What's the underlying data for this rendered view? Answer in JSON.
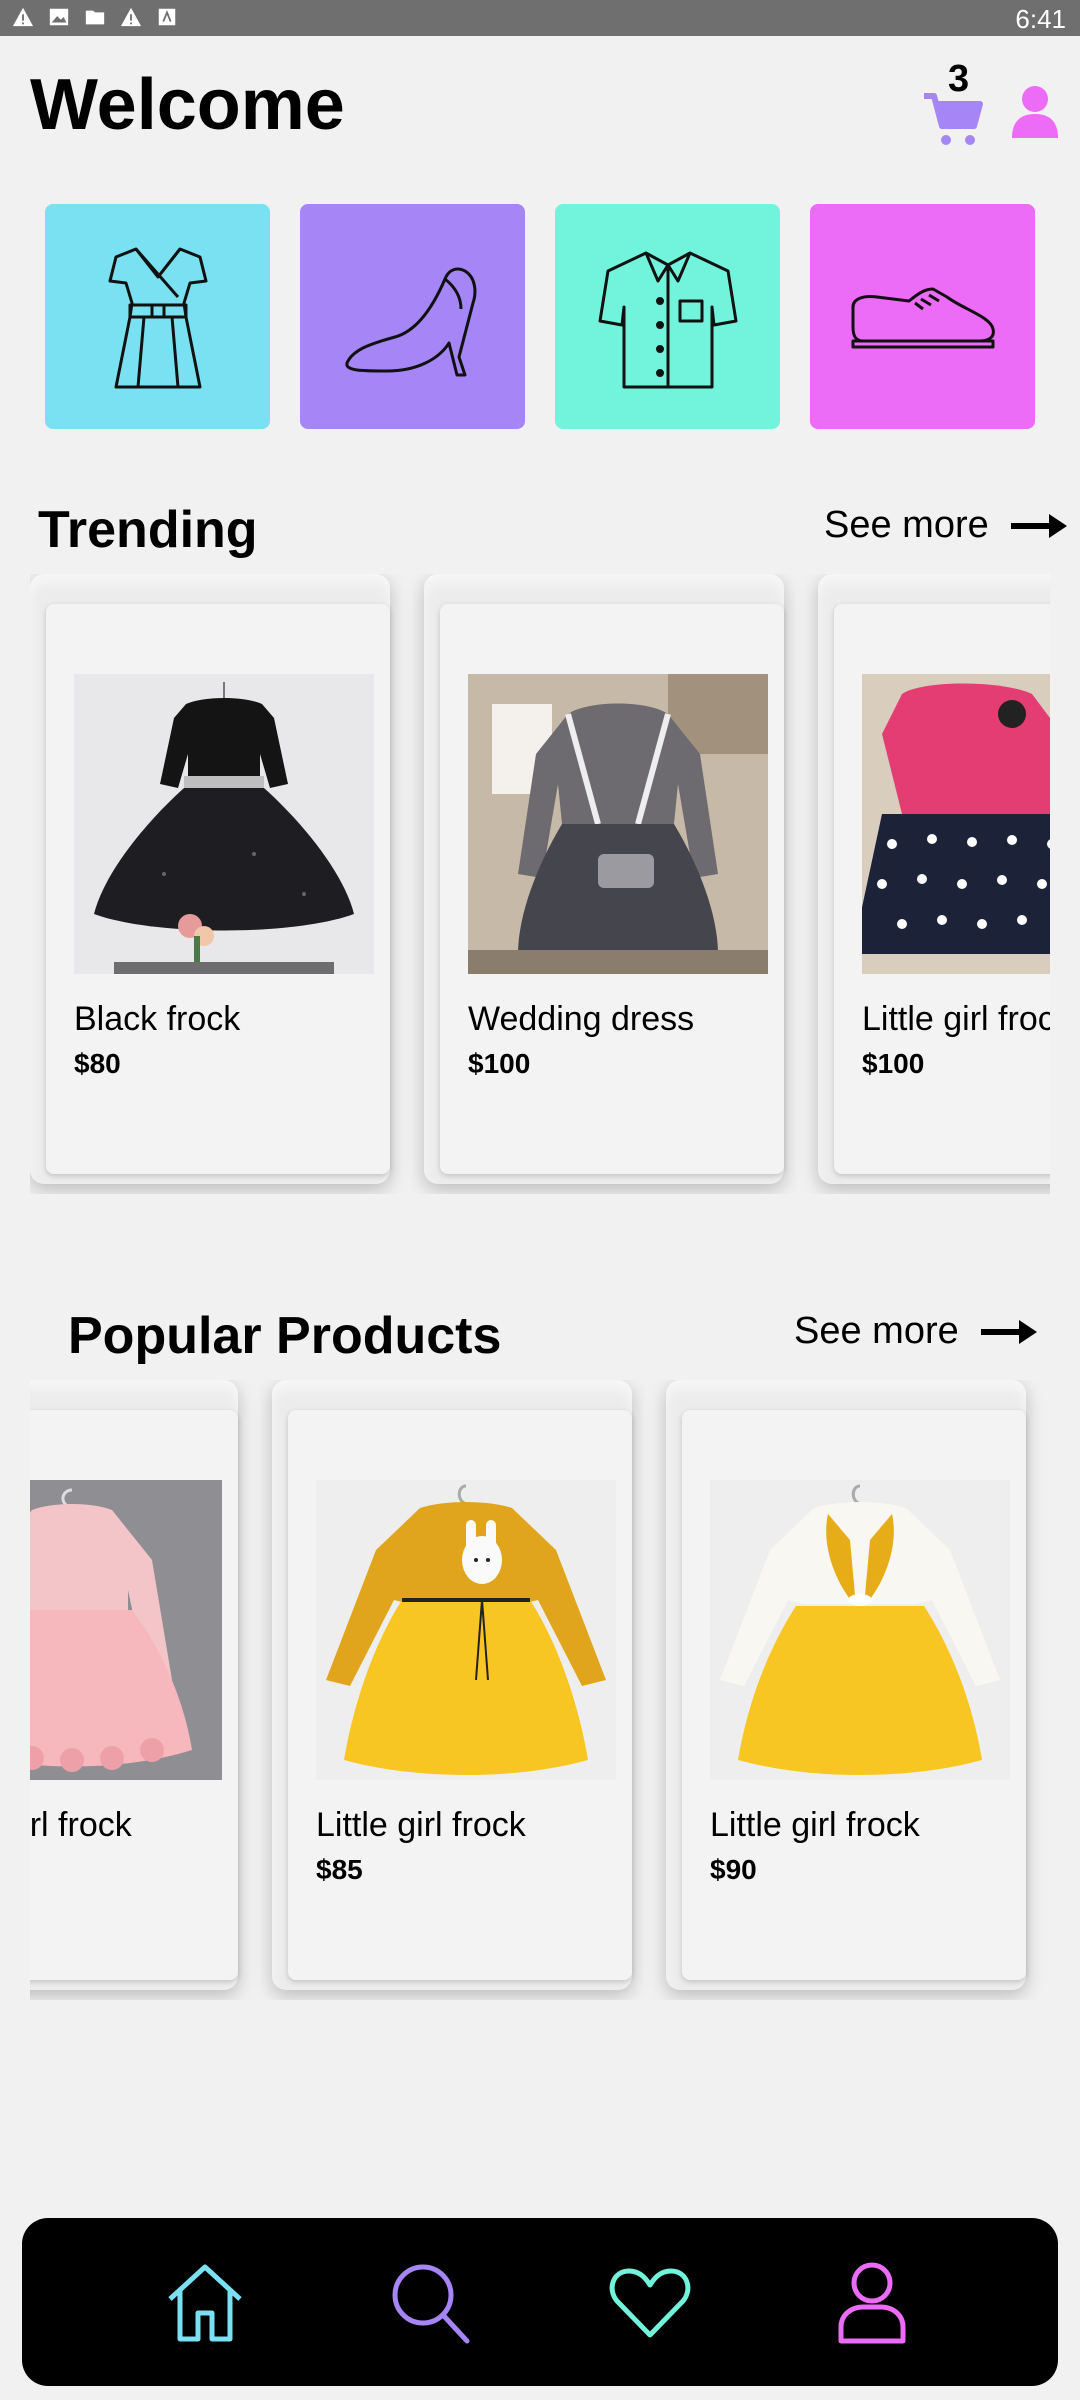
{
  "status_bar": {
    "time": "6:41"
  },
  "header": {
    "title": "Welcome",
    "cart_count": "3"
  },
  "categories": [
    {
      "icon": "dress-icon",
      "color": "#79e1f1"
    },
    {
      "icon": "high-heel-icon",
      "color": "#a685f6"
    },
    {
      "icon": "shirt-icon",
      "color": "#72f4dc"
    },
    {
      "icon": "shoe-icon",
      "color": "#ec6bf7"
    }
  ],
  "trending": {
    "title": "Trending",
    "see_more": "See more",
    "products": [
      {
        "name": "Black frock",
        "price": "$80"
      },
      {
        "name": "Wedding dress",
        "price": "$100"
      },
      {
        "name": "Little girl frock",
        "price": "$100"
      }
    ]
  },
  "popular": {
    "title": "Popular Products",
    "see_more": "See more",
    "products": [
      {
        "name": "Little girl frock",
        "price": ""
      },
      {
        "name": "Little girl frock",
        "price": "$85"
      },
      {
        "name": "Little girl frock",
        "price": "$90"
      }
    ]
  },
  "bottom_nav": {
    "items": [
      {
        "icon": "home-icon",
        "color": "#79e1f1"
      },
      {
        "icon": "search-icon",
        "color": "#a685f6"
      },
      {
        "icon": "heart-icon",
        "color": "#72f4dc"
      },
      {
        "icon": "profile-icon",
        "color": "#ec6bf7"
      }
    ]
  },
  "colors": {
    "accent_purple": "#a685f6",
    "accent_pink": "#ec6bf7"
  }
}
